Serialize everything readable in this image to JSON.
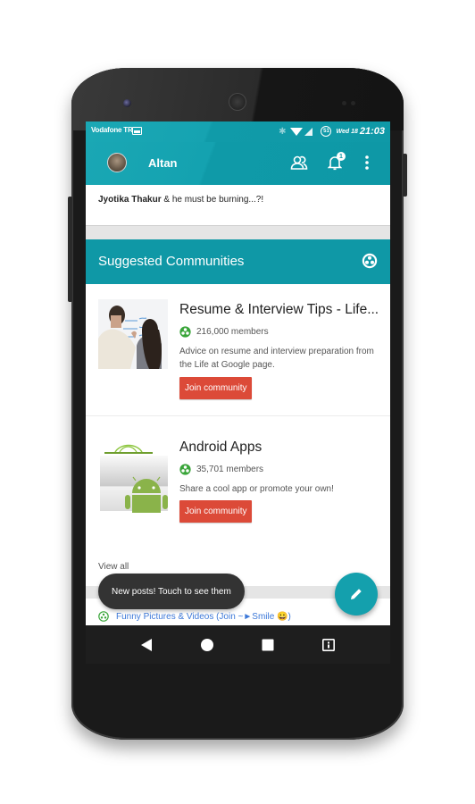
{
  "status_bar": {
    "carrier": "Vodafone TR",
    "battery_level": "51",
    "day": "Wed 18",
    "time": "21:03"
  },
  "app_bar": {
    "title": "Altan",
    "notification_count": "1"
  },
  "post": {
    "author": "Jyotika Thakur",
    "text": " & he must be burning...?!"
  },
  "suggested_communities": {
    "title": "Suggested Communities",
    "items": [
      {
        "name": "Resume & Interview Tips - Life...",
        "members": "216,000 members",
        "description": "Advice on resume and interview preparation from the Life at Google page.",
        "join_label": "Join community"
      },
      {
        "name": "Android Apps",
        "members": "35,701 members",
        "description": "Share a cool app or promote your own!",
        "join_label": "Join community"
      }
    ],
    "view_all_label": "View all"
  },
  "next_item": {
    "label": "Funny Pictures & Videos (Join  ~►Smile 😀)"
  },
  "toast": {
    "text": "New posts! Touch to see them"
  },
  "colors": {
    "primary": "#0f98a6",
    "join_button": "#dc4a38",
    "community_icon": "#3aa53a",
    "link": "#3c78d8"
  }
}
